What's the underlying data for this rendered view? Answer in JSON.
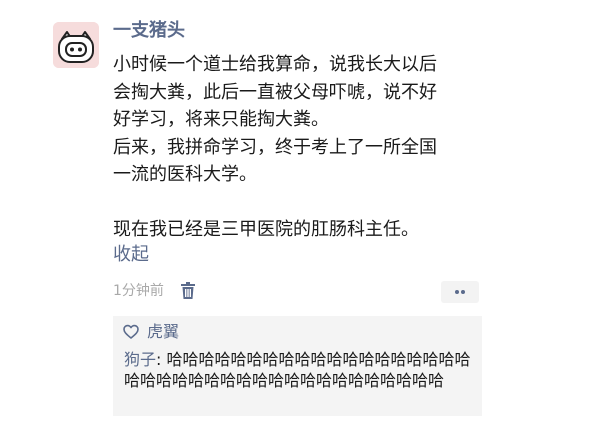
{
  "post": {
    "author": "一支猪头",
    "avatar_icon": "pig-face-icon",
    "content_lines": [
      "小时候一个道士给我算命，说我长大以后",
      "会掏大粪，此后一直被父母吓唬，说不好",
      "好学习，将来只能掏大粪。",
      "后来，我拼命学习，终于考上了一所全国",
      "一流的医科大学。",
      "",
      "现在我已经是三甲医院的肛肠科主任。"
    ],
    "collapse_label": "收起",
    "timestamp": "1分钟前",
    "delete_icon": "trash-icon",
    "more_icon": "more-dots-icon"
  },
  "interactions": {
    "like_icon": "heart-outline-icon",
    "likers": "虎翼",
    "comments": [
      {
        "author": "狗子",
        "separator": ": ",
        "text": "哈哈哈哈哈哈哈哈哈哈哈哈哈哈哈哈哈哈哈哈哈哈哈哈哈哈哈哈哈哈哈哈哈哈哈哈哈哈哈"
      }
    ]
  },
  "colors": {
    "link": "#5b6b8c",
    "text": "#1a1a1a",
    "meta": "#a9a9a9",
    "comment_bg": "#f4f4f4",
    "avatar_bg": "#f6dcdc"
  }
}
